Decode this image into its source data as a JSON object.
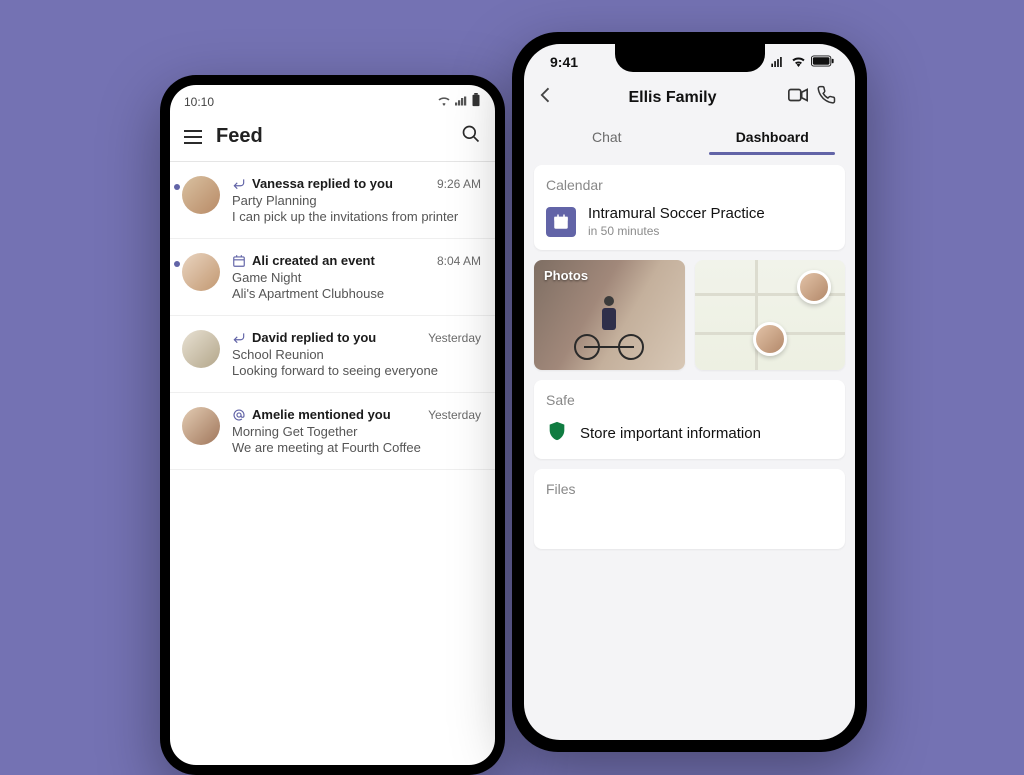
{
  "android": {
    "status_time": "10:10",
    "header_title": "Feed",
    "items": [
      {
        "icon": "reply",
        "headline": "Vanessa replied to you",
        "subject": "Party Planning",
        "message": "I can pick up the invitations from printer",
        "time": "9:26 AM",
        "unread": true
      },
      {
        "icon": "calendar",
        "headline": "Ali created an event",
        "subject": "Game Night",
        "message": "Ali's Apartment Clubhouse",
        "time": "8:04 AM",
        "unread": true
      },
      {
        "icon": "reply",
        "headline": "David replied to you",
        "subject": "School Reunion",
        "message": "Looking forward to seeing everyone",
        "time": "Yesterday",
        "unread": false
      },
      {
        "icon": "mention",
        "headline": "Amelie mentioned you",
        "subject": "Morning Get Together",
        "message": "We are meeting at Fourth Coffee",
        "time": "Yesterday",
        "unread": false
      }
    ]
  },
  "ios": {
    "status_time": "9:41",
    "title": "Ellis Family",
    "tabs": {
      "chat": "Chat",
      "dashboard": "Dashboard"
    },
    "active_tab": "dashboard",
    "calendar": {
      "label": "Calendar",
      "event_title": "Intramural Soccer Practice",
      "event_sub": "in 50 minutes"
    },
    "photos_label": "Photos",
    "safe": {
      "label": "Safe",
      "text": "Store important information"
    },
    "files_label": "Files"
  }
}
